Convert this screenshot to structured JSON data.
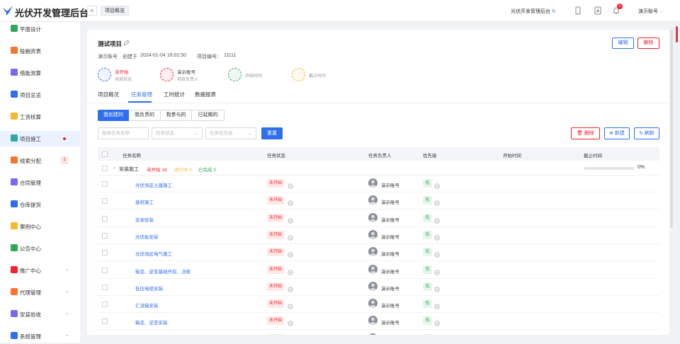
{
  "app": {
    "title": "光伏开发管理后台",
    "current_tab": "项目概览",
    "platform_name": "光伏开发管理后台",
    "account": "演示账号",
    "notification_count": "3"
  },
  "sidebar": {
    "items": [
      {
        "label": "平面设计",
        "icon": "layout-icon",
        "color": "#2ea85a"
      },
      {
        "label": "投融资表",
        "icon": "finance-icon",
        "color": "#f5742e"
      },
      {
        "label": "借能测算",
        "icon": "calc-icon",
        "color": "#7b68ee"
      },
      {
        "label": "项目总览",
        "icon": "overview-icon",
        "color": "#2f6fed"
      },
      {
        "label": "工资核算",
        "icon": "salary-icon",
        "color": "#f5b82e"
      },
      {
        "label": "项目施工",
        "icon": "construction-icon",
        "color": "#2ea8a0",
        "active": true,
        "dot": true
      },
      {
        "label": "线索分配",
        "icon": "clue-icon",
        "color": "#f5742e",
        "count": "1"
      },
      {
        "label": "合同管理",
        "icon": "contract-icon",
        "color": "#7b68ee"
      },
      {
        "label": "仓库提货",
        "icon": "warehouse-icon",
        "color": "#2f6fed"
      },
      {
        "label": "案例中心",
        "icon": "case-icon",
        "color": "#f5b82e"
      },
      {
        "label": "公告中心",
        "icon": "bell-icon",
        "color": "#2ea85a"
      },
      {
        "label": "推广中心",
        "icon": "promote-icon",
        "color": "#f5222d",
        "chevron": true
      },
      {
        "label": "代理管理",
        "icon": "agent-icon",
        "color": "#f5742e",
        "chevron": true
      },
      {
        "label": "安装验收",
        "icon": "install-icon",
        "color": "#7b68ee",
        "chevron": true
      },
      {
        "label": "系统管理",
        "icon": "system-icon",
        "color": "#2f6fed",
        "chevron": true
      }
    ]
  },
  "project": {
    "title": "测试项目",
    "account_label": "演示账号",
    "created_prefix": "创建于",
    "created_at": "2024-01-04 16:02:50",
    "number_label": "项目编号：",
    "number": "11111",
    "edit_label": "编辑",
    "delete_label": "删除",
    "summary": [
      {
        "main": "未开始",
        "sub": "项目状态",
        "color": "#f5222d",
        "icon": "layers-icon",
        "ring": "#2f6fed"
      },
      {
        "main": "演示账号",
        "sub": "项目负责人",
        "color": "#333333",
        "icon": "user-icon",
        "ring": "#f5222d"
      },
      {
        "main": "",
        "sub": "开始时间",
        "color": "#333333",
        "icon": "calendar-start-icon",
        "ring": "#2ea85a"
      },
      {
        "main": "",
        "sub": "截止时间",
        "color": "#333333",
        "icon": "calendar-end-icon",
        "ring": "#f5b82e"
      }
    ]
  },
  "tabs": [
    "项目概况",
    "任务管理",
    "工时统计",
    "数据报表"
  ],
  "filters": {
    "scope": [
      "我创建的",
      "我负责的",
      "我参与的",
      "已延期的"
    ],
    "search_placeholder": "搜索任务名称",
    "status_placeholder": "任务状态",
    "priority_placeholder": "任务优先级",
    "reset_label": "重置",
    "delete_label": "删除",
    "create_label": "新建",
    "refresh_label": "刷新"
  },
  "table": {
    "headers": [
      "任务名称",
      "任务状态",
      "任务负责人",
      "优先级",
      "开始时间",
      "截止时间"
    ],
    "group": {
      "name": "安装施工",
      "not_started": "未开始 16",
      "in_progress": "进行中 0",
      "done": "已完成 0",
      "progress": 0,
      "progress_text": "0%"
    },
    "rows": [
      {
        "name": "光伏场区土建施工",
        "status": "未开始",
        "owner": "演示账号",
        "priority": "低"
      },
      {
        "name": "基桩施工",
        "status": "未开始",
        "owner": "演示账号",
        "priority": "低"
      },
      {
        "name": "支架安装",
        "status": "未开始",
        "owner": "演示账号",
        "priority": "低"
      },
      {
        "name": "光伏板安装",
        "status": "未开始",
        "owner": "演示账号",
        "priority": "低"
      },
      {
        "name": "光伏场区电气施工",
        "status": "未开始",
        "owner": "演示账号",
        "priority": "低"
      },
      {
        "name": "箱变、逆变基础开挖、浇筑",
        "status": "未开始",
        "owner": "演示账号",
        "priority": "低"
      },
      {
        "name": "低压电缆安装",
        "status": "未开始",
        "owner": "演示账号",
        "priority": "低"
      },
      {
        "name": "汇流箱安装",
        "status": "未开始",
        "owner": "演示账号",
        "priority": "低"
      },
      {
        "name": "箱变、逆变安装",
        "status": "未开始",
        "owner": "演示账号",
        "priority": "低"
      },
      {
        "name": "",
        "status": "未开始",
        "owner": "演示账号",
        "priority": "低"
      }
    ]
  }
}
